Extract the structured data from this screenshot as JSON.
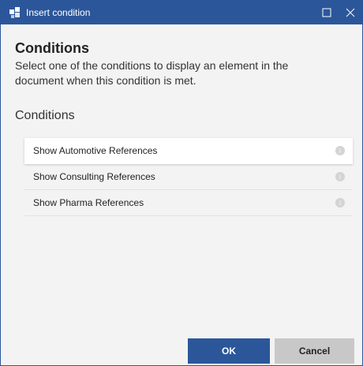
{
  "window": {
    "title": "Insert condition",
    "icons": {
      "app": "app-icon",
      "maximize": "maximize-icon",
      "close": "close-icon"
    }
  },
  "main": {
    "heading": "Conditions",
    "description": "Select one of the conditions to display an element in the document when this condition is met.",
    "section_title": "Conditions",
    "conditions": [
      {
        "label": "Show Automotive References",
        "selected": true
      },
      {
        "label": "Show Consulting References",
        "selected": false
      },
      {
        "label": "Show Pharma References",
        "selected": false
      }
    ]
  },
  "footer": {
    "ok_label": "OK",
    "cancel_label": "Cancel"
  },
  "colors": {
    "accent": "#2b579a",
    "cancel_bg": "#c8c8c8",
    "background": "#f3f3f3"
  }
}
